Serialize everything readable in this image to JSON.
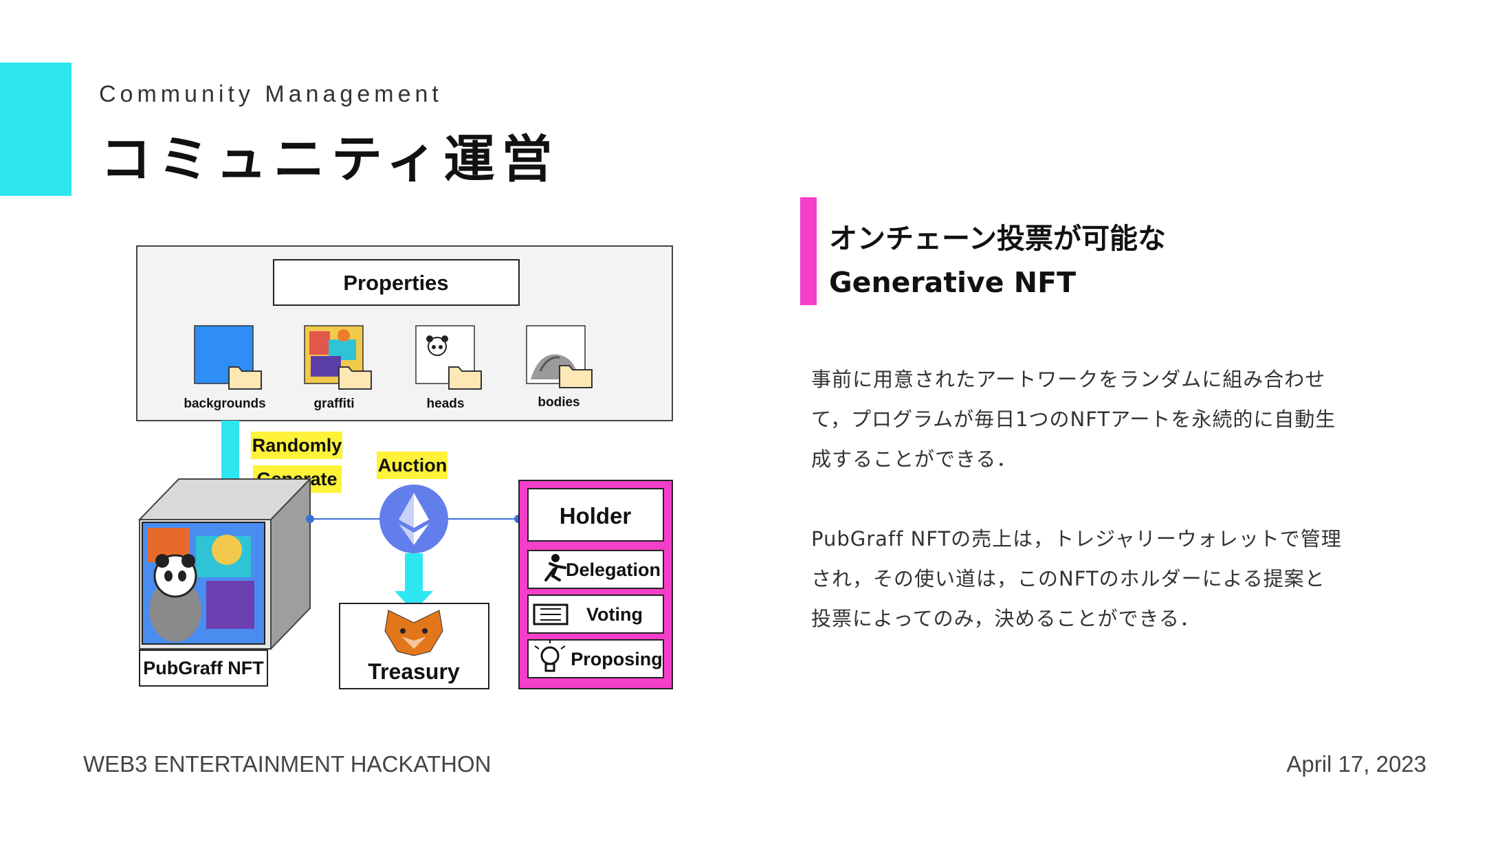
{
  "header": {
    "kicker": "Community Management",
    "title": "コミュニティ運営"
  },
  "diagram": {
    "properties_label": "Properties",
    "folders": [
      "backgrounds",
      "graffiti",
      "heads",
      "bodies"
    ],
    "randomly_label": "Randomly",
    "generate_label": "Generate",
    "auction_label": "Auction",
    "nft_label": "PubGraff NFT",
    "treasury_label": "Treasury",
    "holder_label": "Holder",
    "holder_actions": [
      "Delegation",
      "Voting",
      "Proposing"
    ]
  },
  "section": {
    "headline_line1": "オンチェーン投票が可能な",
    "headline_line2": "Generative NFT",
    "paragraph1": [
      "事前に用意されたアートワークをランダムに組み合わせ",
      "て，プログラムが毎日1つのNFTアートを永続的に自動生",
      "成することができる．"
    ],
    "paragraph2": [
      "PubGraff NFTの売上は，トレジャリーウォレットで管理",
      "され，その使い道は，このNFTのホルダーによる提案と",
      "投票によってのみ，決めることができる．"
    ]
  },
  "footer": {
    "event": "WEB3 ENTERTAINMENT HACKATHON",
    "date": "April 17, 2023"
  },
  "colors": {
    "cyan_accent": "#2de6f0",
    "pink_accent": "#f43fc8",
    "highlight_yellow": "#fff23a",
    "ethereum_blue": "#627eea"
  }
}
